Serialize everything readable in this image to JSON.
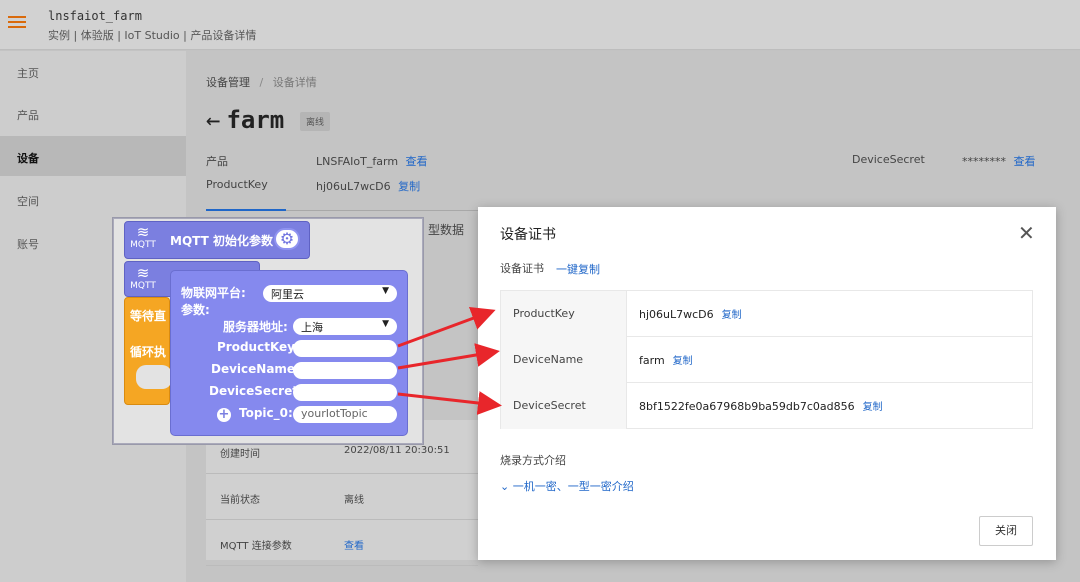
{
  "app": {
    "title": "lnsfaiot_farm",
    "breadcrumb": "实例 | 体验版 | IoT Studio | 产品设备详情"
  },
  "sidebar": {
    "items": [
      {
        "label": "主页"
      },
      {
        "label": "产品"
      },
      {
        "label": "设备",
        "active": true
      },
      {
        "label": "空间"
      },
      {
        "label": "账号"
      }
    ]
  },
  "main": {
    "breadcrumb": {
      "parent": "设备管理",
      "sep": "/",
      "current": "设备详情"
    },
    "title": "farm",
    "status_badge": "离线",
    "product_label": "产品",
    "product_value": "LNSFAIoT_farm",
    "product_link": "查看",
    "productkey_label": "ProductKey",
    "productkey_value": "hj06uL7wcD6",
    "copy_link": "复制",
    "devicesecret_label": "DeviceSecret",
    "devicesecret_value": "********",
    "devicesecret_link": "查看",
    "tab_partial": "型数据",
    "info_rows": [
      {
        "key": "创建时间",
        "value": "2022/08/11 20:30:51"
      },
      {
        "key": "当前状态",
        "value": "离线"
      },
      {
        "key": "MQTT 连接参数",
        "value": "查看"
      }
    ]
  },
  "blocks": {
    "mqtt_label": "MQTT",
    "init_block": "MQTT 初始化参数",
    "wait_block": "等待直",
    "loop_block": "循环执",
    "platform_label": "物联网平台:",
    "platform_value": "阿里云",
    "params_label": "参数:",
    "server_label": "服务器地址:",
    "server_value": "上海",
    "productkey_label": "ProductKey:",
    "devicename_label": "DeviceName:",
    "devicesecret_label": "DeviceSecret:",
    "topic_label": "Topic_0:",
    "topic_value": "yourIotTopic"
  },
  "dialog": {
    "title": "设备证书",
    "subtitle": "设备证书",
    "copy_all": "一键复制",
    "rows": [
      {
        "key": "ProductKey",
        "value": "hj06uL7wcD6",
        "copy": "复制"
      },
      {
        "key": "DeviceName",
        "value": "farm",
        "copy": "复制"
      },
      {
        "key": "DeviceSecret",
        "value": "8bf1522fe0a67968b9ba59db7c0ad856",
        "copy": "复制"
      }
    ],
    "burn_title": "烧录方式介绍",
    "burn_link": "一机一密、一型一密介绍",
    "close_button": "关闭"
  },
  "colors": {
    "arrow": "#e8262b",
    "block_purple": "#7b7fe0",
    "block_orange": "#f5a623",
    "link": "#1f66c8",
    "menu_accent": "#d96a0c"
  }
}
